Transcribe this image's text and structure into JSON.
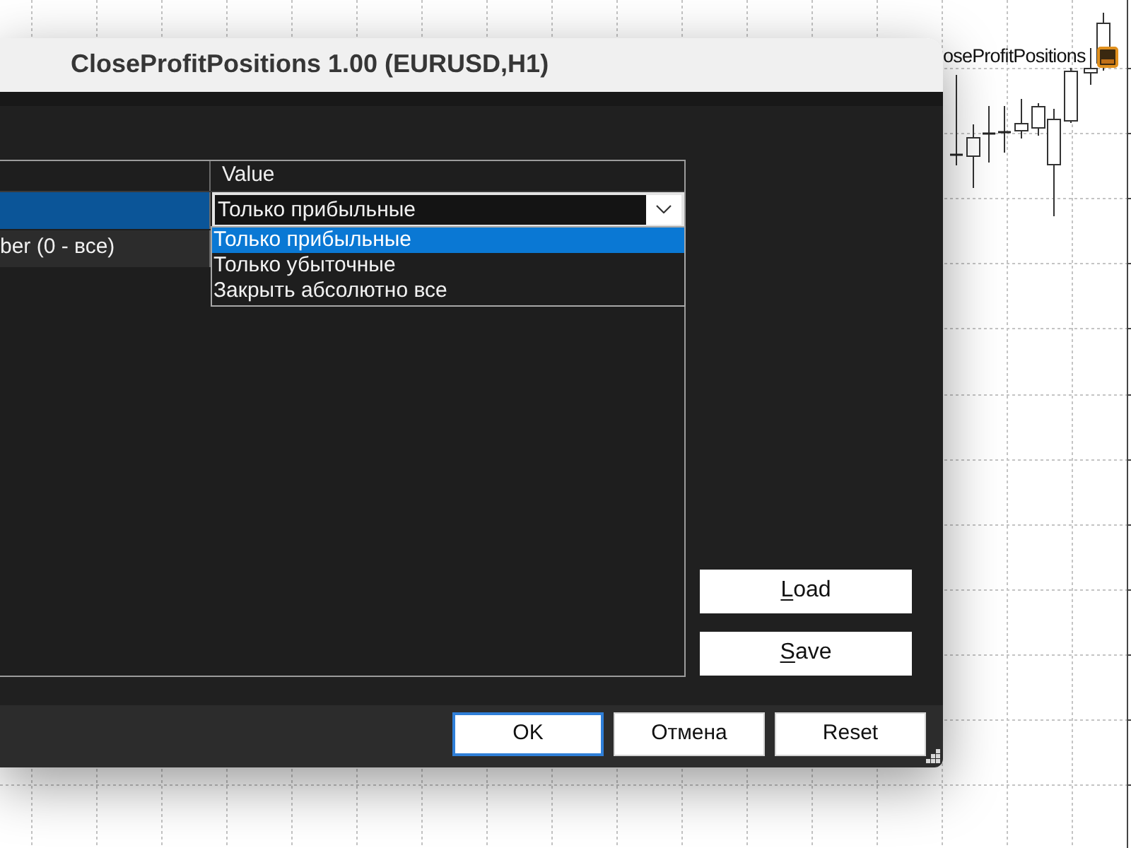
{
  "chart": {
    "indicator_label": "oseProfitPositions"
  },
  "dialog": {
    "title": "CloseProfitPositions 1.00 (EURUSD,H1)",
    "table": {
      "columns": [
        "Value"
      ],
      "rows": [
        {
          "selected": true,
          "value": {
            "kind": "dropdown",
            "text": "Только прибыльные",
            "expanded": true
          }
        },
        {
          "selected": false,
          "name": "ber (0 - все)"
        }
      ]
    },
    "dropdown_list": {
      "options": [
        {
          "label": "Только прибыльные",
          "selected": true
        },
        {
          "label": "Только убыточные",
          "selected": false
        },
        {
          "label": "Закрыть абсолютно все",
          "selected": false
        }
      ]
    },
    "side_buttons": [
      {
        "label": "Load",
        "underline_first": true
      },
      {
        "label": "Save",
        "underline_first": true
      }
    ],
    "footer_buttons": [
      {
        "label": "OK",
        "focused": true
      },
      {
        "label": "Отмена",
        "focused": false
      },
      {
        "label": "Reset",
        "focused": false
      }
    ]
  }
}
